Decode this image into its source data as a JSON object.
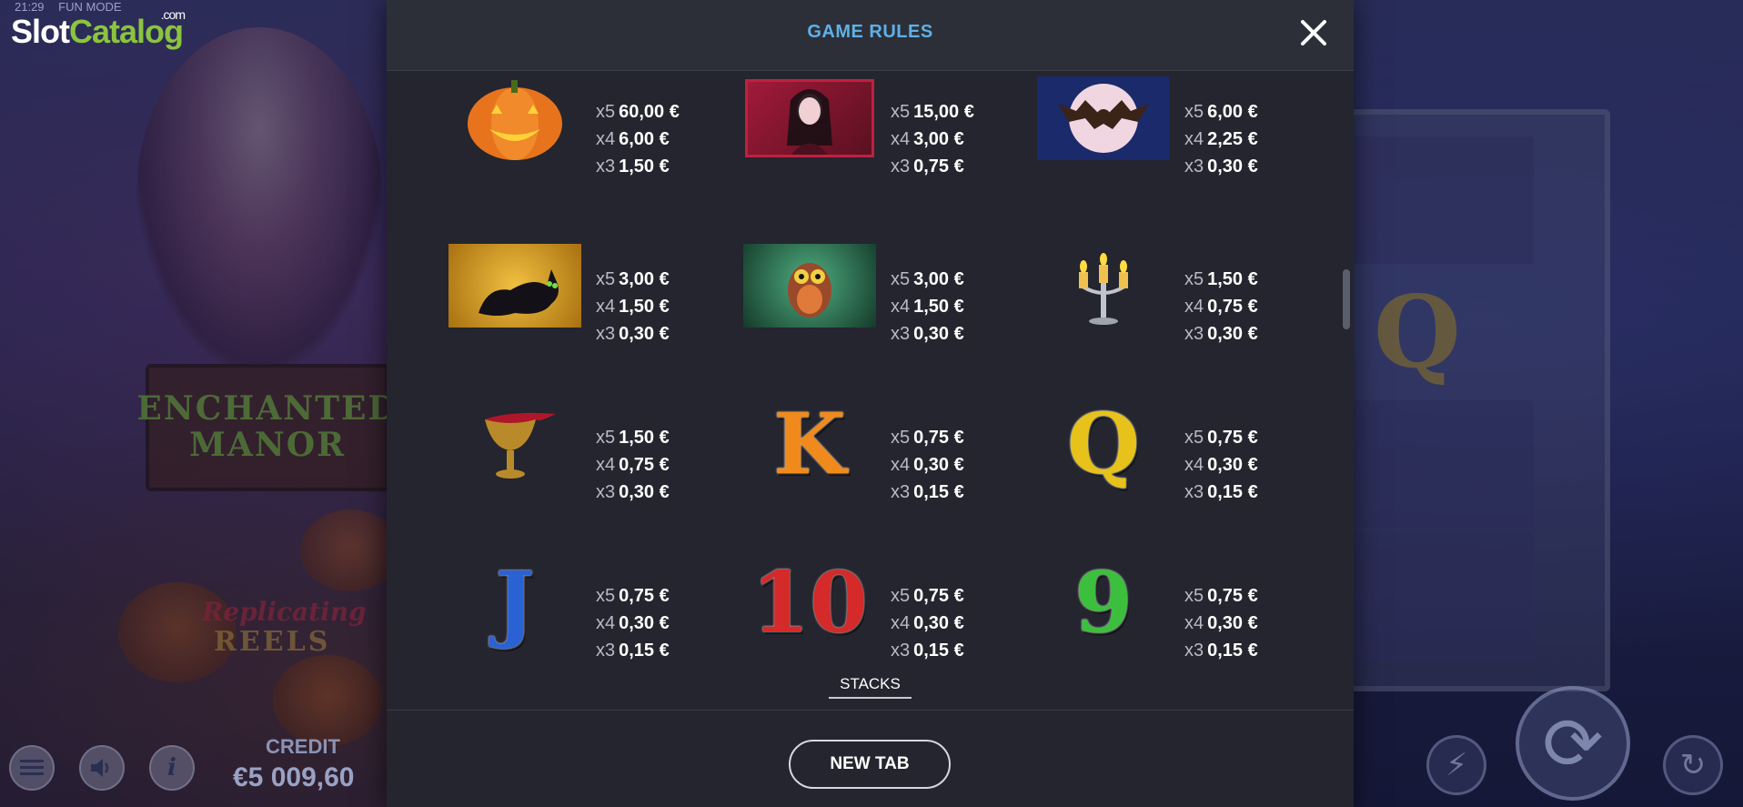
{
  "statusbar": {
    "time": "21:29",
    "mode": "FUN MODE"
  },
  "logo": {
    "slot": "Slot",
    "catalog": "Catalog",
    "com": ".com"
  },
  "game": {
    "sign_line1": "ENCHANTED",
    "sign_line2": "MANOR",
    "feature_line1": "Replicating",
    "feature_line2": "REELS"
  },
  "credit": {
    "label": "CREDIT",
    "value": "€5 009,60"
  },
  "modal": {
    "title": "GAME RULES",
    "stacks_label": "STACKS",
    "new_tab_label": "NEW TAB"
  },
  "paytable": [
    {
      "symbol": "pumpkin-icon",
      "lines": [
        {
          "mult": "x5",
          "amt": "60,00 €"
        },
        {
          "mult": "x4",
          "amt": "6,00 €"
        },
        {
          "mult": "x3",
          "amt": "1,50 €"
        }
      ]
    },
    {
      "symbol": "witch-icon",
      "lines": [
        {
          "mult": "x5",
          "amt": "15,00 €"
        },
        {
          "mult": "x4",
          "amt": "3,00 €"
        },
        {
          "mult": "x3",
          "amt": "0,75 €"
        }
      ]
    },
    {
      "symbol": "bat-icon",
      "lines": [
        {
          "mult": "x5",
          "amt": "6,00 €"
        },
        {
          "mult": "x4",
          "amt": "2,25 €"
        },
        {
          "mult": "x3",
          "amt": "0,30 €"
        }
      ]
    },
    {
      "symbol": "black-cat-icon",
      "lines": [
        {
          "mult": "x5",
          "amt": "3,00 €"
        },
        {
          "mult": "x4",
          "amt": "1,50 €"
        },
        {
          "mult": "x3",
          "amt": "0,30 €"
        }
      ]
    },
    {
      "symbol": "owl-icon",
      "lines": [
        {
          "mult": "x5",
          "amt": "3,00 €"
        },
        {
          "mult": "x4",
          "amt": "1,50 €"
        },
        {
          "mult": "x3",
          "amt": "0,30 €"
        }
      ]
    },
    {
      "symbol": "candelabra-icon",
      "lines": [
        {
          "mult": "x5",
          "amt": "1,50 €"
        },
        {
          "mult": "x4",
          "amt": "0,75 €"
        },
        {
          "mult": "x3",
          "amt": "0,30 €"
        }
      ]
    },
    {
      "symbol": "goblet-icon",
      "lines": [
        {
          "mult": "x5",
          "amt": "1,50 €"
        },
        {
          "mult": "x4",
          "amt": "0,75 €"
        },
        {
          "mult": "x3",
          "amt": "0,30 €"
        }
      ]
    },
    {
      "symbol": "k-icon",
      "letter": "K",
      "lines": [
        {
          "mult": "x5",
          "amt": "0,75 €"
        },
        {
          "mult": "x4",
          "amt": "0,30 €"
        },
        {
          "mult": "x3",
          "amt": "0,15 €"
        }
      ]
    },
    {
      "symbol": "q-icon",
      "letter": "Q",
      "lines": [
        {
          "mult": "x5",
          "amt": "0,75 €"
        },
        {
          "mult": "x4",
          "amt": "0,30 €"
        },
        {
          "mult": "x3",
          "amt": "0,15 €"
        }
      ]
    },
    {
      "symbol": "j-icon",
      "letter": "J",
      "lines": [
        {
          "mult": "x5",
          "amt": "0,75 €"
        },
        {
          "mult": "x4",
          "amt": "0,30 €"
        },
        {
          "mult": "x3",
          "amt": "0,15 €"
        }
      ]
    },
    {
      "symbol": "ten-icon",
      "letter": "10",
      "lines": [
        {
          "mult": "x5",
          "amt": "0,75 €"
        },
        {
          "mult": "x4",
          "amt": "0,30 €"
        },
        {
          "mult": "x3",
          "amt": "0,15 €"
        }
      ]
    },
    {
      "symbol": "nine-icon",
      "letter": "9",
      "lines": [
        {
          "mult": "x5",
          "amt": "0,75 €"
        },
        {
          "mult": "x4",
          "amt": "0,30 €"
        },
        {
          "mult": "x3",
          "amt": "0,15 €"
        }
      ]
    }
  ],
  "colors": {
    "title": "#5fb0e6",
    "modal_bg": "#24252e",
    "logo_green": "#8bc43f"
  }
}
